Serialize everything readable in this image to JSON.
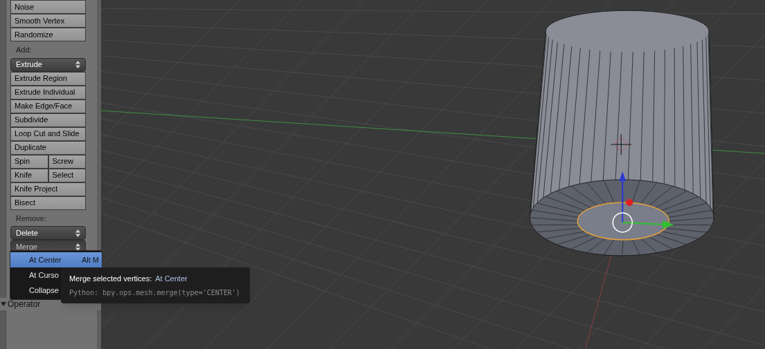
{
  "tool_panel": {
    "top_buttons": [
      "Noise",
      "Smooth Vertex",
      "Randomize"
    ],
    "sections": [
      {
        "label": "Add:",
        "dropdowns": [
          {
            "label": "Extrude",
            "open": false
          }
        ],
        "rows": [
          {
            "buttons": [
              "Extrude Region"
            ]
          },
          {
            "buttons": [
              "Extrude Individual"
            ]
          },
          {
            "buttons": [
              "Make Edge/Face"
            ]
          },
          {
            "buttons": [
              "Subdivide"
            ]
          },
          {
            "buttons": [
              "Loop Cut and Slide"
            ]
          },
          {
            "buttons": [
              "Duplicate"
            ]
          },
          {
            "buttons": [
              "Spin",
              "Screw"
            ]
          },
          {
            "buttons": [
              "Knife",
              "Select"
            ]
          },
          {
            "buttons": [
              "Knife Project"
            ]
          },
          {
            "buttons": [
              "Bisect"
            ]
          }
        ]
      },
      {
        "label": "Remove:",
        "dropdowns": [
          {
            "label": "Delete",
            "open": false
          },
          {
            "label": "Merge",
            "open": true
          }
        ]
      }
    ]
  },
  "merge_menu": {
    "items": [
      {
        "label": "At Center",
        "shortcut": "Alt M",
        "selected": true
      },
      {
        "label": "At Curso",
        "selected": false
      },
      {
        "label": "Collapse",
        "selected": false
      }
    ]
  },
  "tooltip": {
    "title": "Merge selected vertices:",
    "value": "At Center",
    "python": "Python: bpy.ops.mesh.merge(type='CENTER')"
  },
  "operator_panel": {
    "title": "Operator",
    "expanded": true
  }
}
